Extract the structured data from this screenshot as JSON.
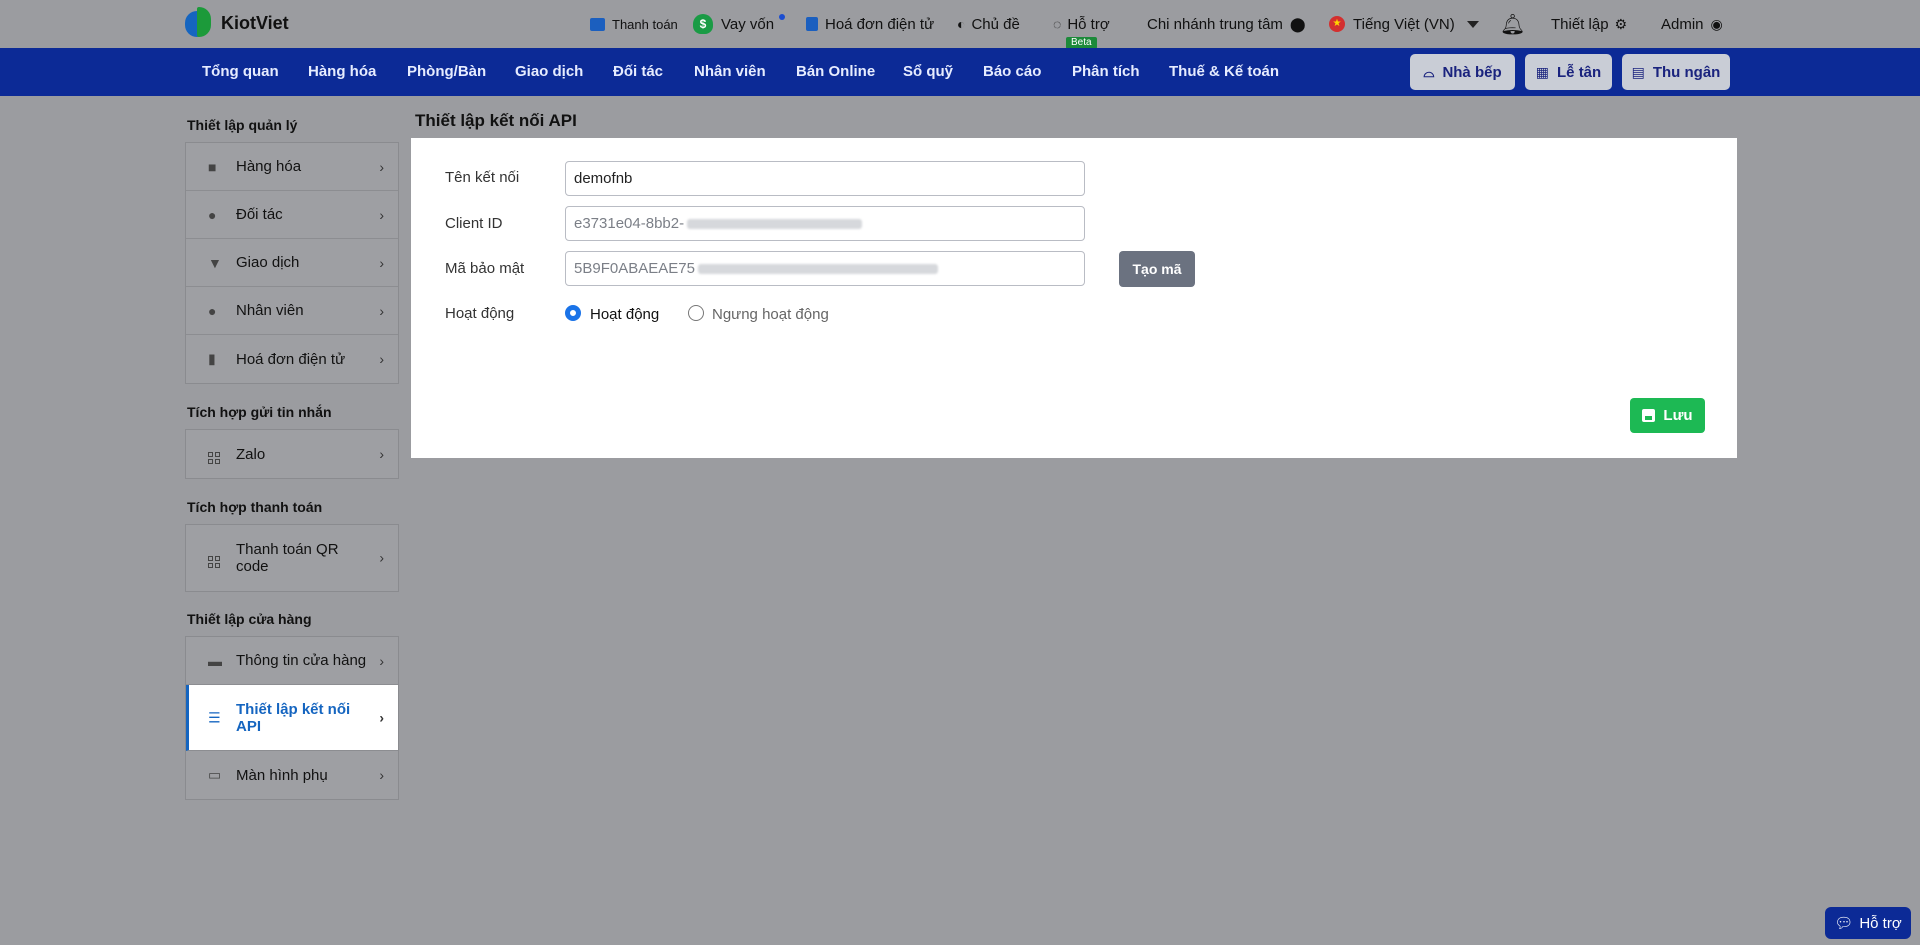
{
  "brand": {
    "name": "KiotViet"
  },
  "topbar": {
    "payment": "Thanh toán",
    "loan": "Vay vốn",
    "einvoice": "Hoá đơn điện tử",
    "theme": "Chủ đề",
    "support": "Hỗ trợ",
    "beta": "Beta",
    "branch": "Chi nhánh trung tâm",
    "language": "Tiếng Việt (VN)",
    "settings": "Thiết lập",
    "user": "Admin"
  },
  "mainnav": {
    "items": [
      "Tổng quan",
      "Hàng hóa",
      "Phòng/Bàn",
      "Giao dịch",
      "Đối tác",
      "Nhân viên",
      "Bán Online",
      "Sổ quỹ",
      "Báo cáo",
      "Phân tích",
      "Thuế & Kế toán"
    ],
    "kitchen": "Nhà bếp",
    "reception": "Lễ tân",
    "cashier": "Thu ngân"
  },
  "sidebar": {
    "sections": [
      {
        "title": "Thiết lập quản lý",
        "items": [
          "Hàng hóa",
          "Đối tác",
          "Giao dịch",
          "Nhân viên",
          "Hoá đơn điện tử"
        ]
      },
      {
        "title": "Tích hợp gửi tin nhắn",
        "items": [
          "Zalo"
        ]
      },
      {
        "title": "Tích hợp thanh toán",
        "items": [
          "Thanh toán QR code"
        ]
      },
      {
        "title": "Thiết lập cửa hàng",
        "items": [
          "Thông tin cửa hàng",
          "Thiết lập kết nối API",
          "Màn hình phụ"
        ]
      }
    ],
    "active": "Thiết lập kết nối API"
  },
  "form": {
    "page_title": "Thiết lập kết nối API",
    "name_label": "Tên kết nối",
    "name_value": "demofnb",
    "client_id_label": "Client ID",
    "client_id_value": "e3731e04-8bb2-",
    "secret_label": "Mã bảo mật",
    "secret_value": "5B9F0ABAEAE75",
    "generate_button": "Tạo mã",
    "status_label": "Hoạt động",
    "status_options": [
      "Hoạt động",
      "Ngưng hoạt động"
    ],
    "status_selected": "Hoạt động",
    "save_button": "Lưu"
  },
  "floating": {
    "support": "Hỗ trợ"
  },
  "colors": {
    "nav": "#0c2a96",
    "accent": "#1a73e8",
    "save": "#1db954"
  }
}
